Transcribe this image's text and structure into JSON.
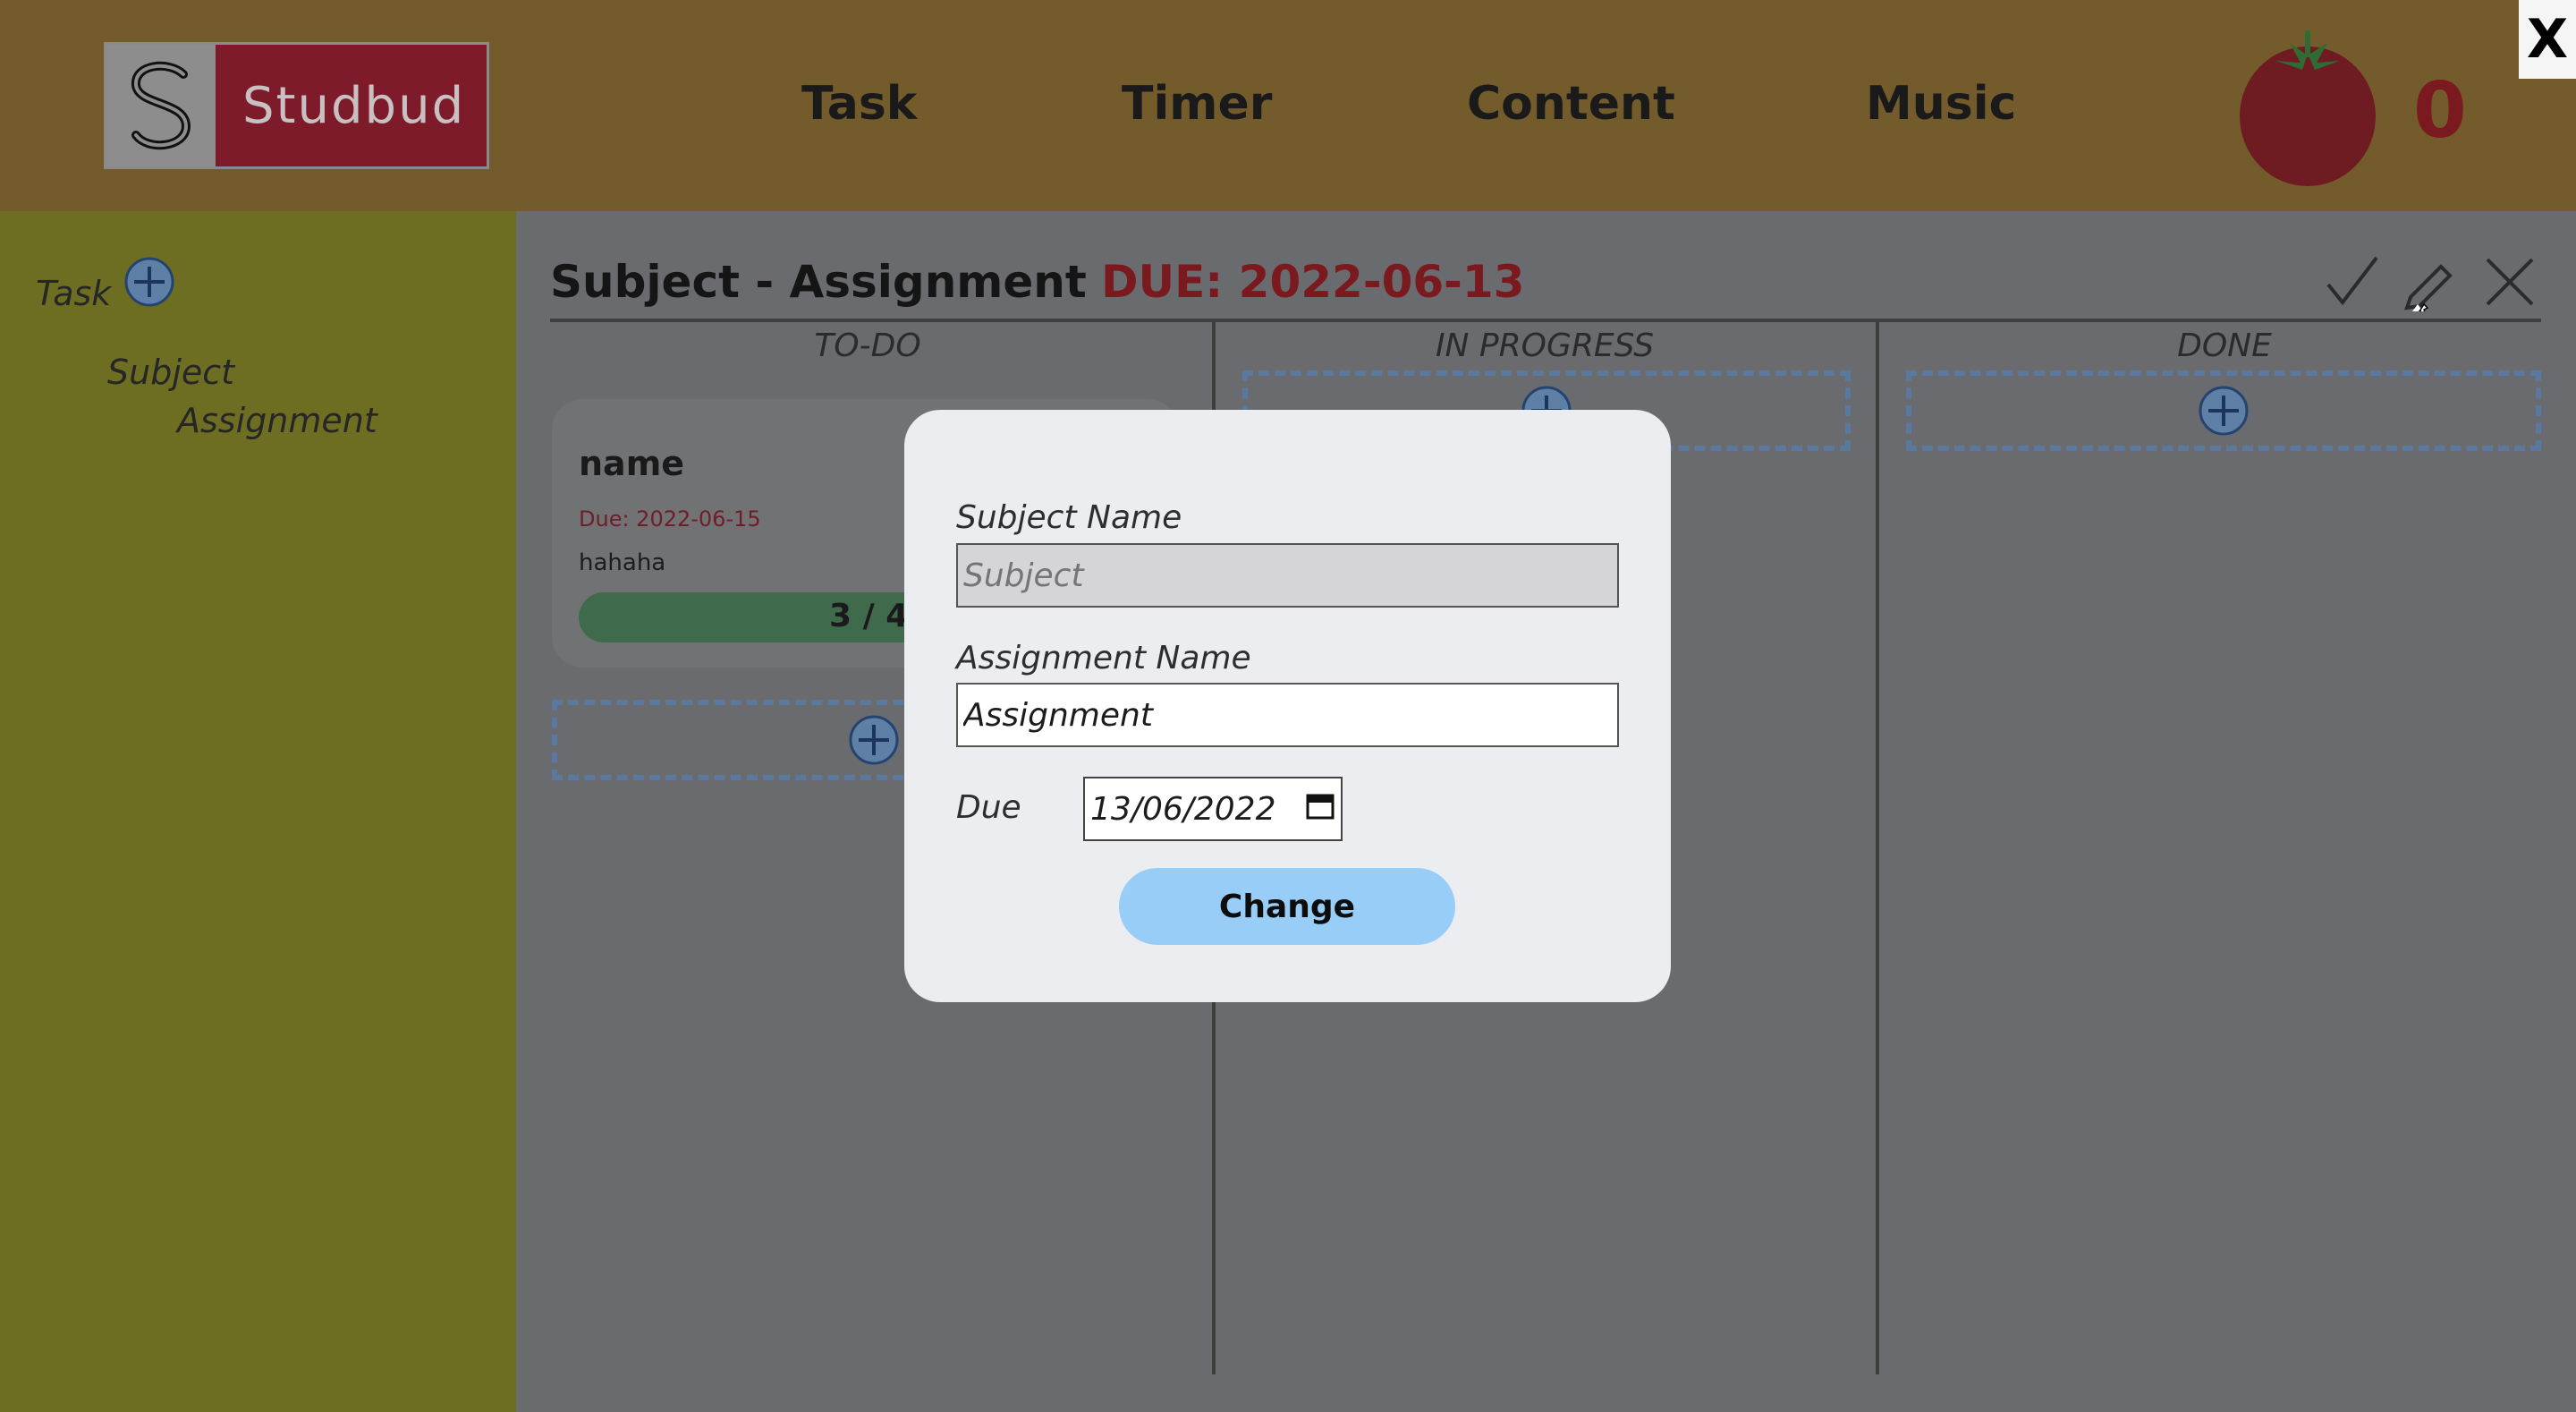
{
  "app": {
    "name": "Studbud"
  },
  "nav": {
    "items": [
      "Task",
      "Timer",
      "Content",
      "Music"
    ]
  },
  "pomodoro": {
    "count": "0"
  },
  "window": {
    "close_label": "X"
  },
  "sidebar": {
    "task_label": "Task",
    "subject": "Subject",
    "assignment": "Assignment"
  },
  "board": {
    "title": "Subject - Assignment",
    "due": "DUE: 2022-06-13",
    "columns": [
      "TO-DO",
      "IN PROGRESS",
      "DONE"
    ],
    "card": {
      "name": "name",
      "due": "Due: 2022-06-15",
      "description": "hahaha",
      "progress_text": "3 / 4",
      "progress": 0.75
    }
  },
  "modal": {
    "subject_label": "Subject Name",
    "subject_placeholder": "Subject",
    "assignment_label": "Assignment Name",
    "assignment_value": "Assignment",
    "due_label": "Due",
    "due_value": "13/06/2022",
    "button": "Change"
  },
  "colors": {
    "header": "#735b2c",
    "sidebar": "#6e6e23",
    "due_red": "#7a1a1f",
    "button": "#98cdf7",
    "progress": "#3f6a4c"
  },
  "icons": [
    "logo-s-icon",
    "tomato-icon",
    "plus-circle-icon",
    "check-icon",
    "pencil-icon",
    "close-icon",
    "calendar-icon"
  ]
}
